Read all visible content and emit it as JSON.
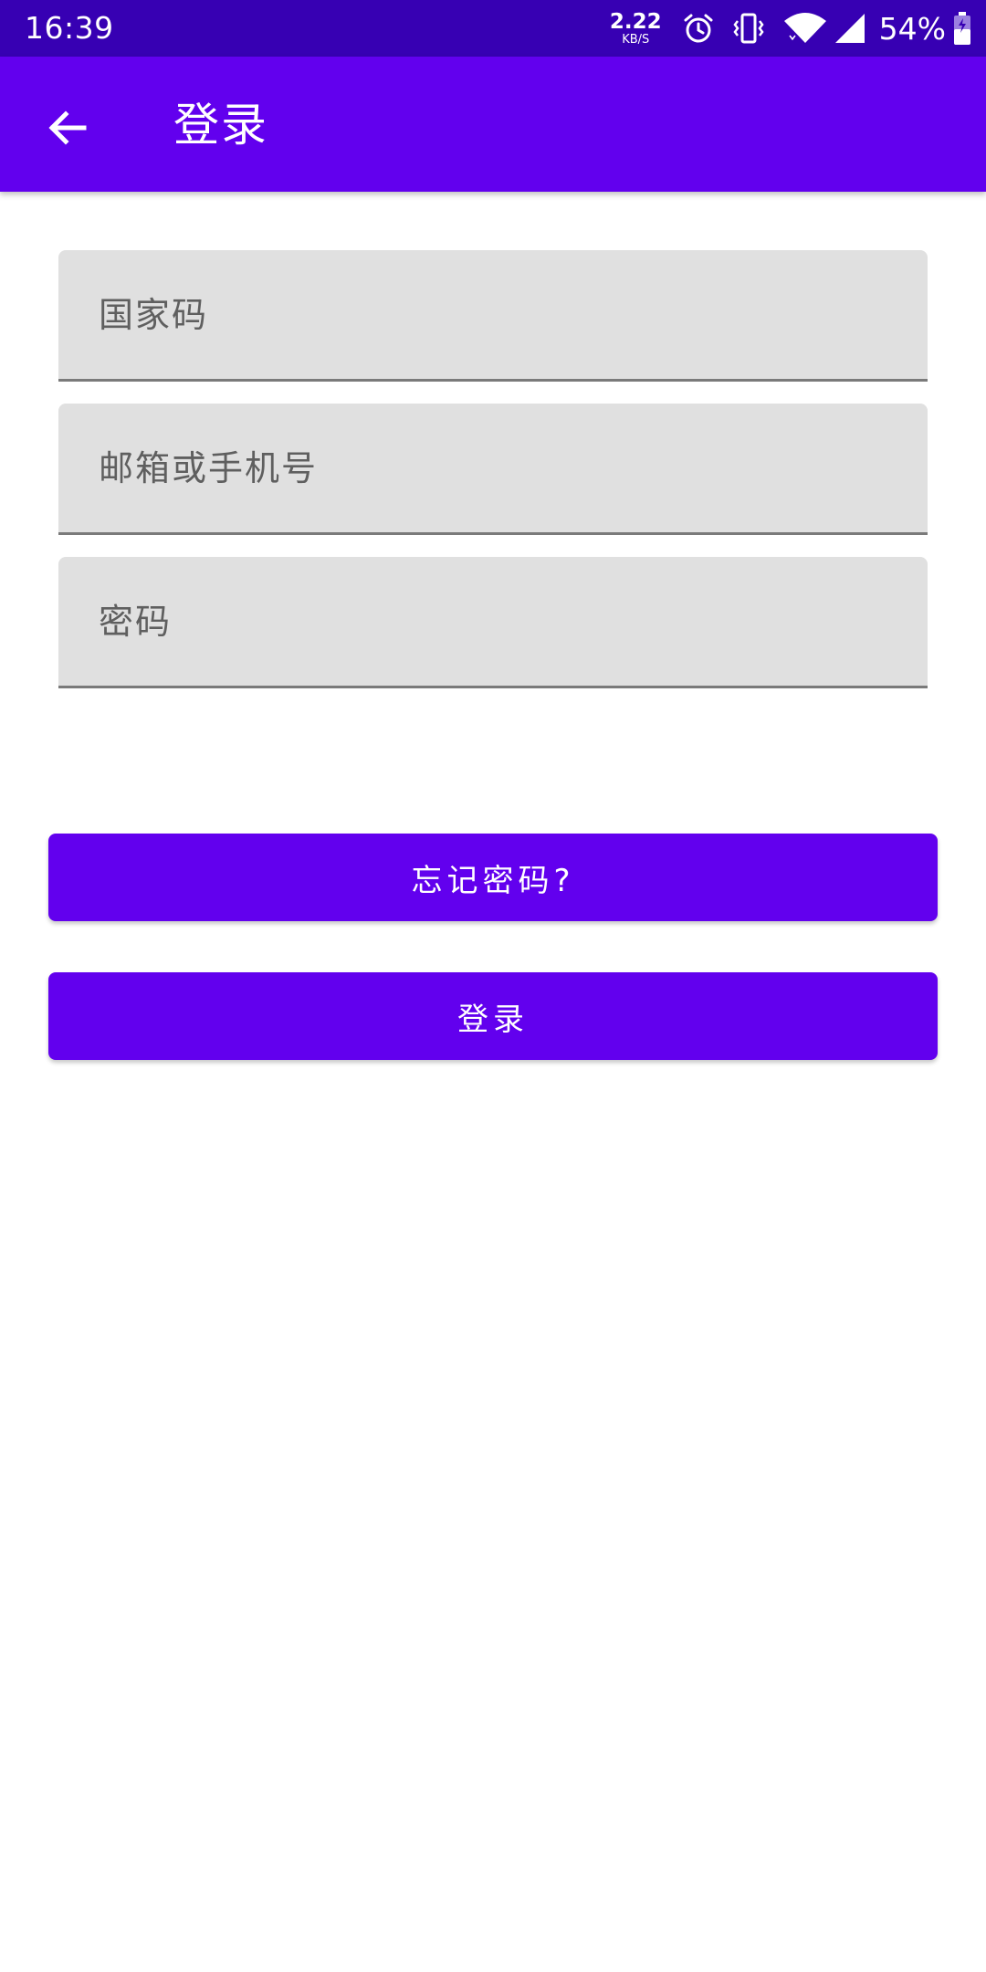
{
  "status_bar": {
    "time": "16:39",
    "net_speed_value": "2.22",
    "net_speed_unit": "KB/S",
    "battery_percent": "54%",
    "icons": [
      "alarm-icon",
      "vibrate-icon",
      "wifi-icon",
      "cell-signal-icon",
      "battery-icon"
    ]
  },
  "app_bar": {
    "title": "登录",
    "back_icon": "arrow-left-icon"
  },
  "form": {
    "country_code_placeholder": "国家码",
    "account_placeholder": "邮箱或手机号",
    "password_placeholder": "密码"
  },
  "buttons": {
    "forgot_password": "忘记密码?",
    "login": "登录"
  },
  "colors": {
    "status_bar": "#3700b3",
    "primary": "#6200ee",
    "field_bg": "#e0e0e0",
    "field_underline": "#7a7a7a",
    "hint_text": "#5f5f5f"
  }
}
